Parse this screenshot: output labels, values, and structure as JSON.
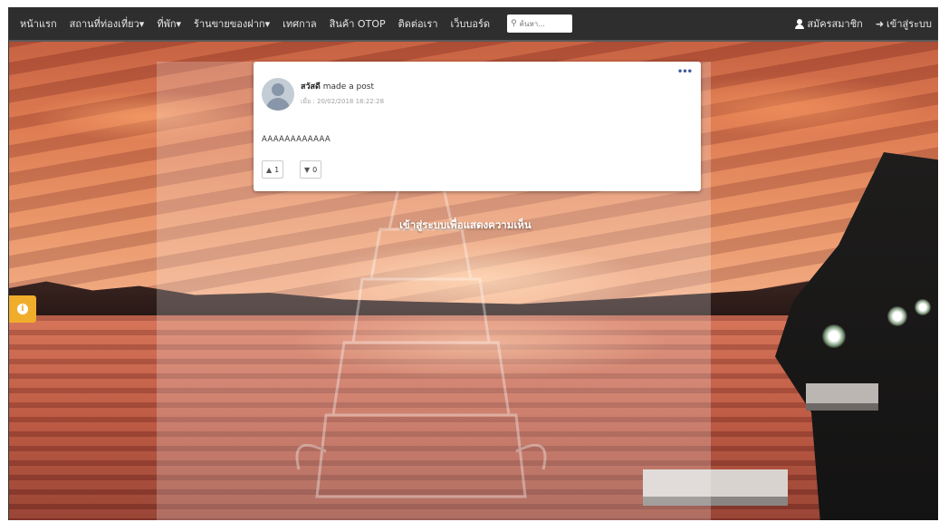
{
  "navbar": {
    "items": [
      {
        "label": "หน้าแรก"
      },
      {
        "label": "สถานที่ท่องเที่ยว",
        "caret": "▾"
      },
      {
        "label": "ที่พัก",
        "caret": "▾"
      },
      {
        "label": "ร้านขายของฝาก",
        "caret": "▾"
      },
      {
        "label": "เทศกาล"
      },
      {
        "label": "สินค้า OTOP"
      },
      {
        "label": "ติดต่อเรา"
      },
      {
        "label": "เว็บบอร์ด"
      }
    ],
    "search_placeholder": "ค้นหา...",
    "search_icon": "magnifier-icon",
    "register_label": "สมัครสมาชิก",
    "login_label": "เข้าสู่ระบบ",
    "login_icon": "sign-in-icon"
  },
  "post": {
    "author": "สวัสดี",
    "action": "made a post",
    "date": "เมื่อ : 20/02/2018 18:22:28",
    "content": "AAAAAAAAAAAA",
    "more": "•••",
    "like_count": "1",
    "dislike_count": "0",
    "like_icon": "thumbs-up-icon",
    "dislike_icon": "thumbs-down-icon"
  },
  "login_prompt": "เข้าสู่ระบบเพื่อแสดงความเห็น",
  "info_button": {
    "glyph": "i",
    "color": "#f0ad2c"
  }
}
